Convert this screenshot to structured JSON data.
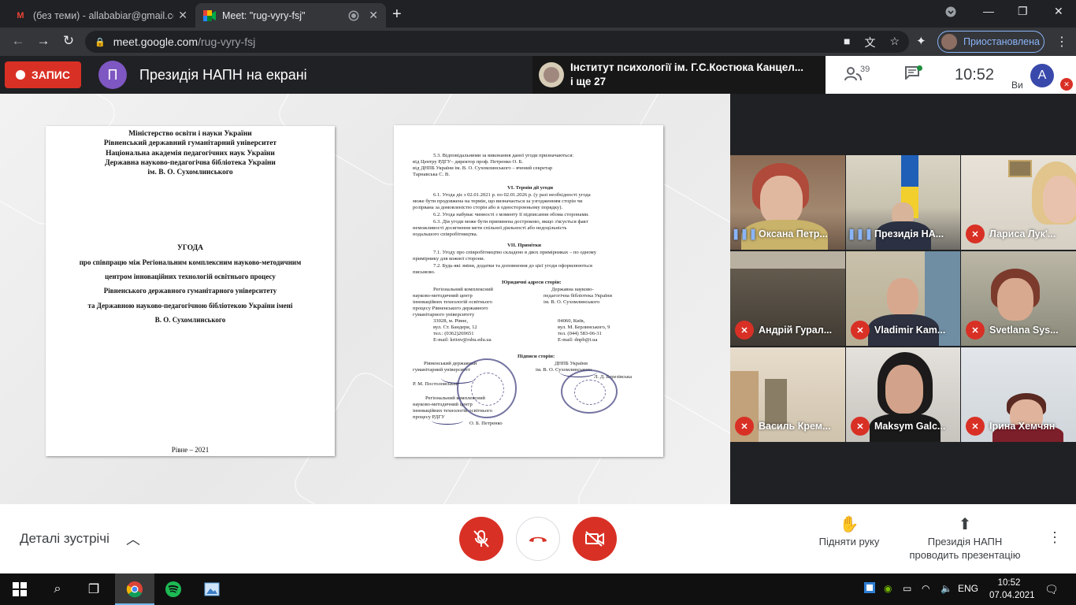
{
  "browser": {
    "tabs": [
      {
        "title": "(без теми) - allababiar@gmail.co",
        "icon": "gmail-icon",
        "active": false
      },
      {
        "title": "Meet: \"rug-vyry-fsj\"",
        "icon": "meet-icon",
        "active": true
      }
    ],
    "new_tab": "+",
    "url_host": "meet.google.com",
    "url_path": "/rug-vyry-fsj",
    "profile_label": "Приостановлена"
  },
  "meet": {
    "record_label": "ЗАПИС",
    "presenter_initial": "П",
    "presenter_title": "Президія НАПН на екрані",
    "speaker_line1": "Інститут психології ім. Г.С.Костюка Канцел...",
    "speaker_line2": "і ще 27",
    "participant_count": "39",
    "clock": "10:52",
    "me_label": "Ви",
    "me_initial": "A",
    "details_label": "Деталі зустрічі",
    "raise_hand_label": "Підняти руку",
    "presenting_line1": "Президія НАПН",
    "presenting_line2": "проводить презентацію"
  },
  "document": {
    "page1": {
      "header": [
        "Міністерство освіти і науки України",
        "Рівненський державний гуманітарний університет",
        "Національна академія педагогічних наук України",
        "Державна науково-педагогічна бібліотека України",
        "ім. В. О. Сухомлинського"
      ],
      "title": "УГОДА",
      "subtitle": [
        "про співпрацю між Регіональним комплексним науково-методичним",
        "центром інноваційних технологій освітнього процесу",
        "Рівненського державного гуманітарного університету",
        "та Державною науково-педагогічною бібліотекою України імені",
        "В. О. Сухомлинського"
      ],
      "city_year": "Рівне – 2021"
    },
    "page2": {
      "lines": [
        "5.3. Відповідальними за виконання даної угоди призначаються:",
        "від Центру РДГУ– директор проф. Петренко О. Б.",
        "від    ДНПБ    України    ім. В. О. Сухомлинського  –  вчений   секретар",
        "Тарнавська С. В.",
        "VI. Термін дії угоди",
        "6.1. Угода діє з 02.01.2021 р. по 02.01.2026 р. (у разі необхідності угода",
        "може бути продовжена на термін, що визначається за узгодженням сторін чи",
        "розірвана за домовленістю сторін або в односторонньому порядку).",
        "6.2. Угода набуває чинності з моменту її підписання обома сторонами.",
        "6.3. Дія угоди може бути припинена достроково, якщо з'ясується факт",
        "неможливості  досягнення  мети  спільної  діяльності  або  недоцільність",
        "подальшого співробітництва.",
        "VII. Примітки",
        "7.1. Угоду про співробітництво складено в двох примірниках – по одному",
        "примірнику для кожної сторони.",
        "7.2. Будь-які зміни, додатки та доповнення до цієї угоди оформлюються",
        "письмово.",
        "Юридичні адреси сторін:"
      ],
      "left_address": [
        "Регіональний комплексний",
        "науково-методичний центр",
        "інноваційних технологій освітнього",
        "процесу Рівненського державного",
        "гуманітарного університету",
        "33028, м. Рівне,",
        "вул. Ст. Бандери, 12",
        "тел.: (0362)269651",
        "E-mail: kriinv@rshu.edu.ua"
      ],
      "right_address": [
        "Державна науково-",
        "педагогічна бібліотека України",
        "ім. В. О. Сухомлинського",
        "04060, Київ,",
        "вул. М. Берлинського, 9",
        "тел. (044) 583-06-31",
        "E-mail: dnpb@i.ua"
      ],
      "signatures_title": "Підписи сторін:",
      "left_sign": [
        "Рівненський державний",
        "гуманітарний університет",
        "Р. М. Постоловський",
        "Регіональний комплексний",
        "науково-методичний центр",
        "інноваційних технологій освітнього",
        "процесу РДГУ",
        "О. Б. Петренко"
      ],
      "right_sign": [
        "ДНПБ України",
        "ім. В. О. Сухомлинського",
        "Л. Д. Березівська"
      ]
    }
  },
  "participants": [
    {
      "name": "Оксана Петр...",
      "status": "speaking"
    },
    {
      "name": "Президія НА...",
      "status": "speaking"
    },
    {
      "name": "Лариса Лук'...",
      "status": "muted"
    },
    {
      "name": "Андрій Гурал...",
      "status": "muted"
    },
    {
      "name": "Vladimir Kam...",
      "status": "muted"
    },
    {
      "name": "Svetlana Sys...",
      "status": "muted"
    },
    {
      "name": "Василь Крем...",
      "status": "muted"
    },
    {
      "name": "Maksym Galc...",
      "status": "muted"
    },
    {
      "name": "Ірина Хемчян",
      "status": "muted"
    }
  ],
  "taskbar": {
    "language": "ENG",
    "time": "10:52",
    "date": "07.04.2021"
  },
  "colors": {
    "record_red": "#d93025",
    "accent_blue": "#8ab4f8",
    "presenter_purple": "#7e57c2"
  }
}
